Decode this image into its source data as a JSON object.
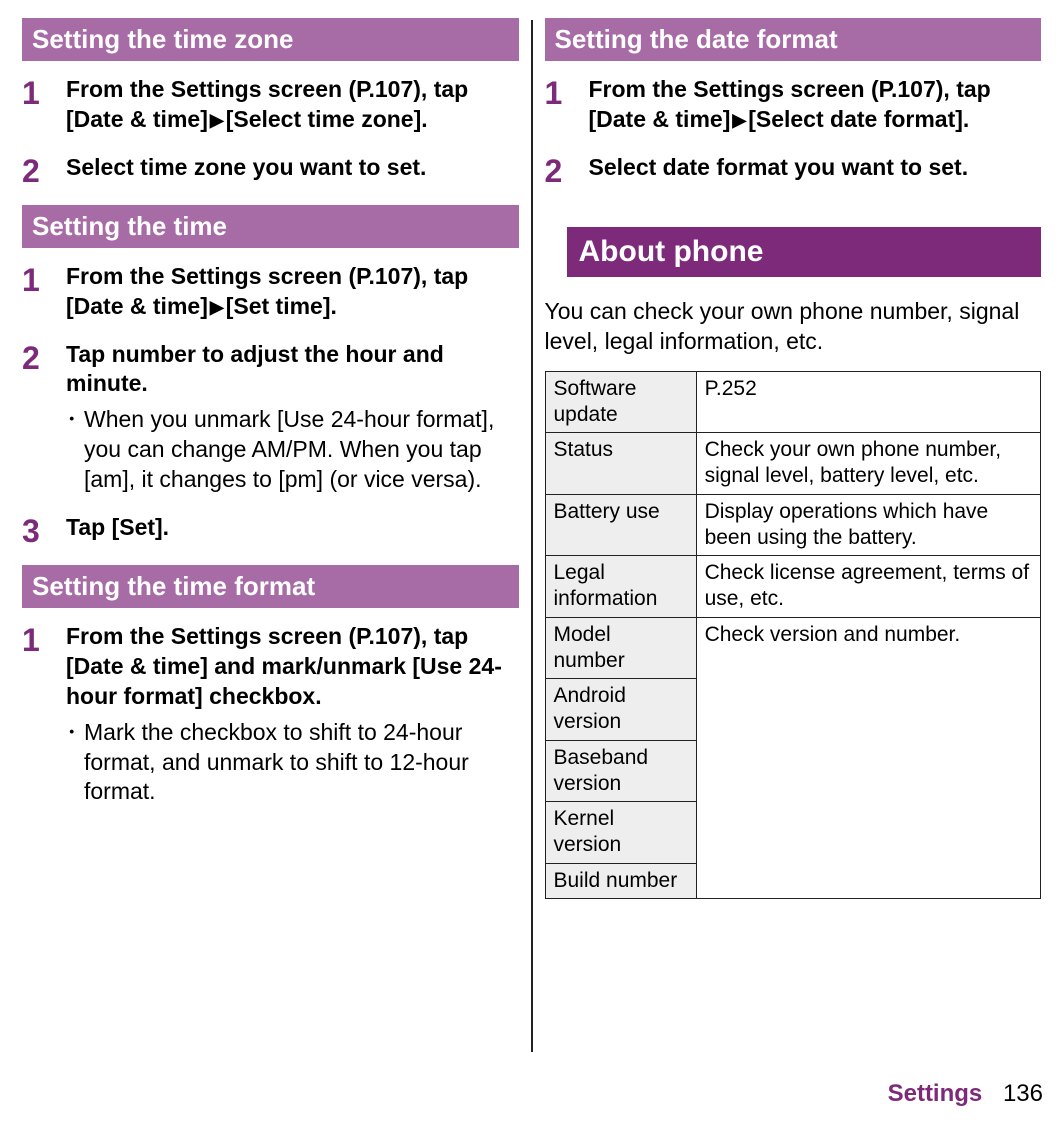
{
  "arrow": "▶",
  "left": {
    "sec1": {
      "heading": "Setting the time zone",
      "steps": [
        {
          "num": "1",
          "main_pre": "From the Settings screen (P.107), tap [Date & time]",
          "main_post": "[Select time zone]."
        },
        {
          "num": "2",
          "main": "Select time zone you want to set."
        }
      ]
    },
    "sec2": {
      "heading": "Setting the time",
      "steps": [
        {
          "num": "1",
          "main_pre": "From the Settings screen (P.107), tap [Date & time]",
          "main_post": "[Set time]."
        },
        {
          "num": "2",
          "main": "Tap number to adjust the hour and minute.",
          "bullet": "When you unmark [Use 24-hour format], you can change AM/PM. When you tap [am], it changes to [pm] (or vice versa)."
        },
        {
          "num": "3",
          "main": "Tap [Set]."
        }
      ]
    },
    "sec3": {
      "heading": "Setting the time format",
      "steps": [
        {
          "num": "1",
          "main": "From the Settings screen (P.107), tap [Date & time] and mark/unmark [Use 24-hour format] checkbox.",
          "bullet": "Mark the checkbox to shift to 24-hour format, and unmark to shift to 12-hour format."
        }
      ]
    }
  },
  "right": {
    "sec1": {
      "heading": "Setting the date format",
      "steps": [
        {
          "num": "1",
          "main_pre": "From the Settings screen (P.107), tap [Date & time]",
          "main_post": "[Select date format]."
        },
        {
          "num": "2",
          "main": "Select date format you want to set."
        }
      ]
    },
    "major": {
      "heading": "About phone",
      "intro": "You can check your own phone number, signal level, legal information, etc.",
      "table": {
        "rows": [
          {
            "label": "Software update",
            "desc": "P.252"
          },
          {
            "label": "Status",
            "desc": "Check your own phone number, signal level, battery level, etc."
          },
          {
            "label": "Battery use",
            "desc": "Display operations which have been using the battery."
          },
          {
            "label": "Legal information",
            "desc": "Check license agreement, terms of use, etc."
          }
        ],
        "spanGroup": {
          "labels": [
            "Model number",
            "Android version",
            "Baseband version",
            "Kernel version",
            "Build number"
          ],
          "desc": "Check version and number."
        }
      }
    }
  },
  "footer": {
    "chapter": "Settings",
    "page": "136"
  }
}
